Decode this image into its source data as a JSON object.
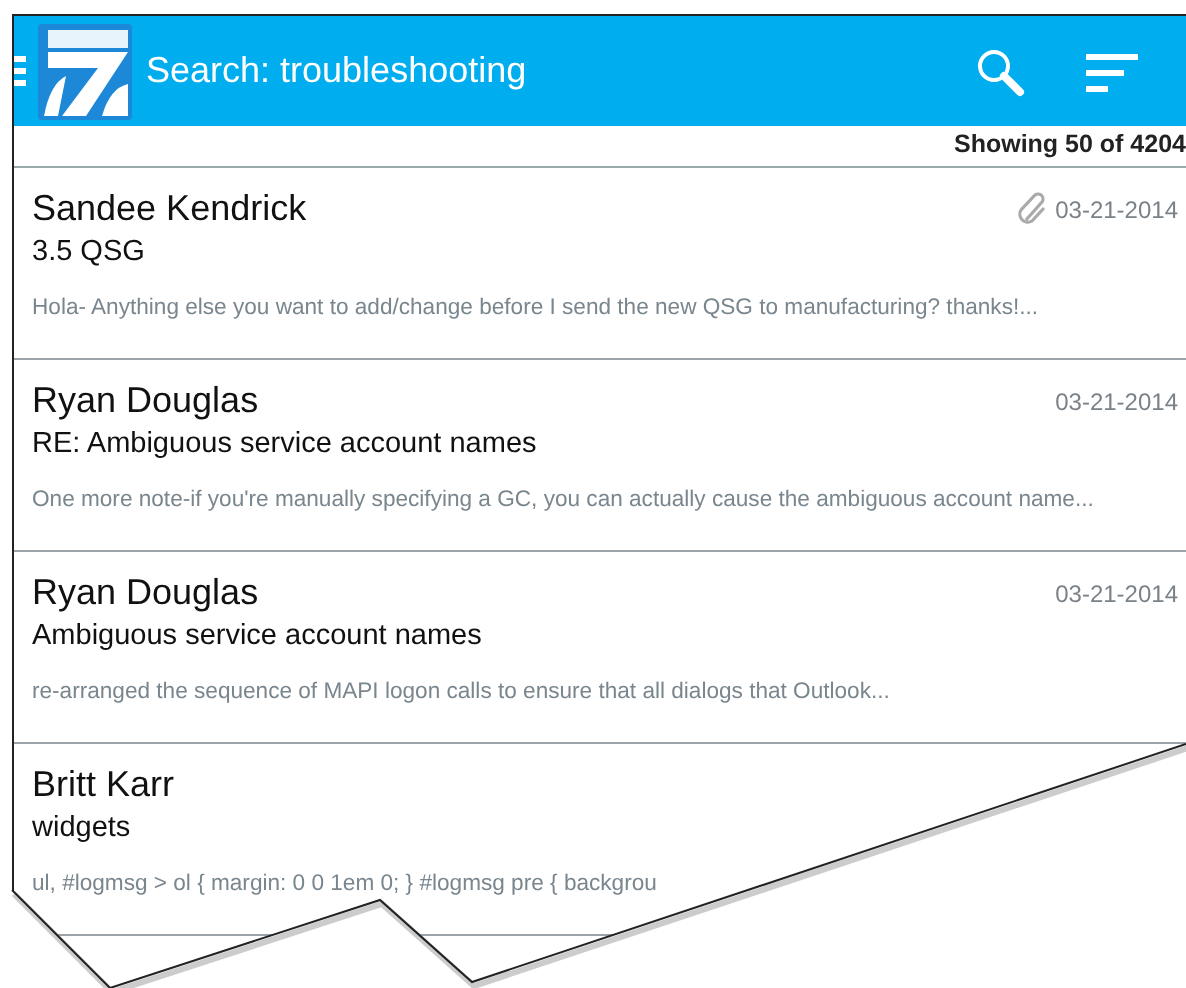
{
  "app_bar": {
    "title": "Search: troubleshooting"
  },
  "result_count": "Showing 50 of 4204",
  "messages": [
    {
      "sender": "Sandee Kendrick",
      "subject": "3.5 QSG",
      "preview": "Hola- Anything else you want to add/change before I send the new QSG to manufacturing? thanks!...",
      "date": "03-21-2014",
      "attachment": true
    },
    {
      "sender": "Ryan Douglas",
      "subject": "RE: Ambiguous service account names",
      "preview": "One more note-if you're manually specifying a GC, you can actually cause the ambiguous account name...",
      "date": "03-21-2014",
      "attachment": false
    },
    {
      "sender": "Ryan Douglas",
      "subject": "Ambiguous service account names",
      "preview": "re-arranged the sequence of MAPI logon calls to ensure that all dialogs that Outlook...",
      "date": "03-21-2014",
      "attachment": false
    },
    {
      "sender": "Britt Karr",
      "subject": "widgets",
      "preview": "ul, #logmsg > ol { margin: 0 0 1em 0; } #logmsg pre { backgrou",
      "attachment": false
    }
  ]
}
